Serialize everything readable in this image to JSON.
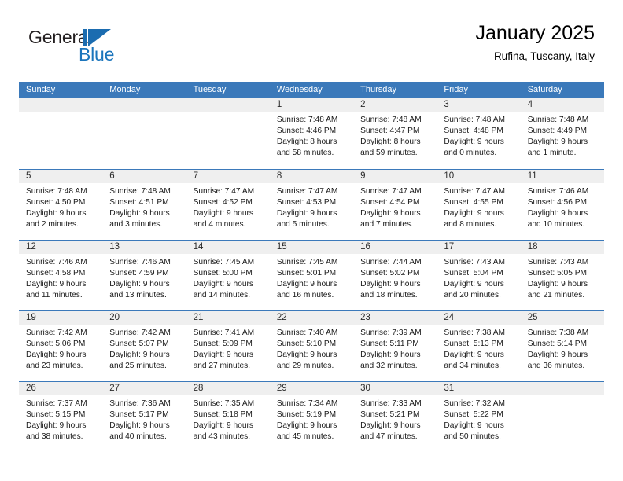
{
  "brand": {
    "name_part1": "General",
    "name_part2": "Blue",
    "mark_icon": "flag-triangle-icon",
    "accent_color": "#1b6cb0"
  },
  "header": {
    "title": "January 2025",
    "subtitle": "Rufina, Tuscany, Italy"
  },
  "theme": {
    "header_blue": "#3b79ba",
    "day_strip_gray": "#efefef",
    "text_color": "#1a1a1a"
  },
  "weekdays": [
    "Sunday",
    "Monday",
    "Tuesday",
    "Wednesday",
    "Thursday",
    "Friday",
    "Saturday"
  ],
  "weeks": [
    [
      {
        "day": "",
        "sunrise": "",
        "sunset": "",
        "daylight1": "",
        "daylight2": ""
      },
      {
        "day": "",
        "sunrise": "",
        "sunset": "",
        "daylight1": "",
        "daylight2": ""
      },
      {
        "day": "",
        "sunrise": "",
        "sunset": "",
        "daylight1": "",
        "daylight2": ""
      },
      {
        "day": "1",
        "sunrise": "Sunrise: 7:48 AM",
        "sunset": "Sunset: 4:46 PM",
        "daylight1": "Daylight: 8 hours",
        "daylight2": "and 58 minutes."
      },
      {
        "day": "2",
        "sunrise": "Sunrise: 7:48 AM",
        "sunset": "Sunset: 4:47 PM",
        "daylight1": "Daylight: 8 hours",
        "daylight2": "and 59 minutes."
      },
      {
        "day": "3",
        "sunrise": "Sunrise: 7:48 AM",
        "sunset": "Sunset: 4:48 PM",
        "daylight1": "Daylight: 9 hours",
        "daylight2": "and 0 minutes."
      },
      {
        "day": "4",
        "sunrise": "Sunrise: 7:48 AM",
        "sunset": "Sunset: 4:49 PM",
        "daylight1": "Daylight: 9 hours",
        "daylight2": "and 1 minute."
      }
    ],
    [
      {
        "day": "5",
        "sunrise": "Sunrise: 7:48 AM",
        "sunset": "Sunset: 4:50 PM",
        "daylight1": "Daylight: 9 hours",
        "daylight2": "and 2 minutes."
      },
      {
        "day": "6",
        "sunrise": "Sunrise: 7:48 AM",
        "sunset": "Sunset: 4:51 PM",
        "daylight1": "Daylight: 9 hours",
        "daylight2": "and 3 minutes."
      },
      {
        "day": "7",
        "sunrise": "Sunrise: 7:47 AM",
        "sunset": "Sunset: 4:52 PM",
        "daylight1": "Daylight: 9 hours",
        "daylight2": "and 4 minutes."
      },
      {
        "day": "8",
        "sunrise": "Sunrise: 7:47 AM",
        "sunset": "Sunset: 4:53 PM",
        "daylight1": "Daylight: 9 hours",
        "daylight2": "and 5 minutes."
      },
      {
        "day": "9",
        "sunrise": "Sunrise: 7:47 AM",
        "sunset": "Sunset: 4:54 PM",
        "daylight1": "Daylight: 9 hours",
        "daylight2": "and 7 minutes."
      },
      {
        "day": "10",
        "sunrise": "Sunrise: 7:47 AM",
        "sunset": "Sunset: 4:55 PM",
        "daylight1": "Daylight: 9 hours",
        "daylight2": "and 8 minutes."
      },
      {
        "day": "11",
        "sunrise": "Sunrise: 7:46 AM",
        "sunset": "Sunset: 4:56 PM",
        "daylight1": "Daylight: 9 hours",
        "daylight2": "and 10 minutes."
      }
    ],
    [
      {
        "day": "12",
        "sunrise": "Sunrise: 7:46 AM",
        "sunset": "Sunset: 4:58 PM",
        "daylight1": "Daylight: 9 hours",
        "daylight2": "and 11 minutes."
      },
      {
        "day": "13",
        "sunrise": "Sunrise: 7:46 AM",
        "sunset": "Sunset: 4:59 PM",
        "daylight1": "Daylight: 9 hours",
        "daylight2": "and 13 minutes."
      },
      {
        "day": "14",
        "sunrise": "Sunrise: 7:45 AM",
        "sunset": "Sunset: 5:00 PM",
        "daylight1": "Daylight: 9 hours",
        "daylight2": "and 14 minutes."
      },
      {
        "day": "15",
        "sunrise": "Sunrise: 7:45 AM",
        "sunset": "Sunset: 5:01 PM",
        "daylight1": "Daylight: 9 hours",
        "daylight2": "and 16 minutes."
      },
      {
        "day": "16",
        "sunrise": "Sunrise: 7:44 AM",
        "sunset": "Sunset: 5:02 PM",
        "daylight1": "Daylight: 9 hours",
        "daylight2": "and 18 minutes."
      },
      {
        "day": "17",
        "sunrise": "Sunrise: 7:43 AM",
        "sunset": "Sunset: 5:04 PM",
        "daylight1": "Daylight: 9 hours",
        "daylight2": "and 20 minutes."
      },
      {
        "day": "18",
        "sunrise": "Sunrise: 7:43 AM",
        "sunset": "Sunset: 5:05 PM",
        "daylight1": "Daylight: 9 hours",
        "daylight2": "and 21 minutes."
      }
    ],
    [
      {
        "day": "19",
        "sunrise": "Sunrise: 7:42 AM",
        "sunset": "Sunset: 5:06 PM",
        "daylight1": "Daylight: 9 hours",
        "daylight2": "and 23 minutes."
      },
      {
        "day": "20",
        "sunrise": "Sunrise: 7:42 AM",
        "sunset": "Sunset: 5:07 PM",
        "daylight1": "Daylight: 9 hours",
        "daylight2": "and 25 minutes."
      },
      {
        "day": "21",
        "sunrise": "Sunrise: 7:41 AM",
        "sunset": "Sunset: 5:09 PM",
        "daylight1": "Daylight: 9 hours",
        "daylight2": "and 27 minutes."
      },
      {
        "day": "22",
        "sunrise": "Sunrise: 7:40 AM",
        "sunset": "Sunset: 5:10 PM",
        "daylight1": "Daylight: 9 hours",
        "daylight2": "and 29 minutes."
      },
      {
        "day": "23",
        "sunrise": "Sunrise: 7:39 AM",
        "sunset": "Sunset: 5:11 PM",
        "daylight1": "Daylight: 9 hours",
        "daylight2": "and 32 minutes."
      },
      {
        "day": "24",
        "sunrise": "Sunrise: 7:38 AM",
        "sunset": "Sunset: 5:13 PM",
        "daylight1": "Daylight: 9 hours",
        "daylight2": "and 34 minutes."
      },
      {
        "day": "25",
        "sunrise": "Sunrise: 7:38 AM",
        "sunset": "Sunset: 5:14 PM",
        "daylight1": "Daylight: 9 hours",
        "daylight2": "and 36 minutes."
      }
    ],
    [
      {
        "day": "26",
        "sunrise": "Sunrise: 7:37 AM",
        "sunset": "Sunset: 5:15 PM",
        "daylight1": "Daylight: 9 hours",
        "daylight2": "and 38 minutes."
      },
      {
        "day": "27",
        "sunrise": "Sunrise: 7:36 AM",
        "sunset": "Sunset: 5:17 PM",
        "daylight1": "Daylight: 9 hours",
        "daylight2": "and 40 minutes."
      },
      {
        "day": "28",
        "sunrise": "Sunrise: 7:35 AM",
        "sunset": "Sunset: 5:18 PM",
        "daylight1": "Daylight: 9 hours",
        "daylight2": "and 43 minutes."
      },
      {
        "day": "29",
        "sunrise": "Sunrise: 7:34 AM",
        "sunset": "Sunset: 5:19 PM",
        "daylight1": "Daylight: 9 hours",
        "daylight2": "and 45 minutes."
      },
      {
        "day": "30",
        "sunrise": "Sunrise: 7:33 AM",
        "sunset": "Sunset: 5:21 PM",
        "daylight1": "Daylight: 9 hours",
        "daylight2": "and 47 minutes."
      },
      {
        "day": "31",
        "sunrise": "Sunrise: 7:32 AM",
        "sunset": "Sunset: 5:22 PM",
        "daylight1": "Daylight: 9 hours",
        "daylight2": "and 50 minutes."
      },
      {
        "day": "",
        "sunrise": "",
        "sunset": "",
        "daylight1": "",
        "daylight2": ""
      }
    ]
  ]
}
